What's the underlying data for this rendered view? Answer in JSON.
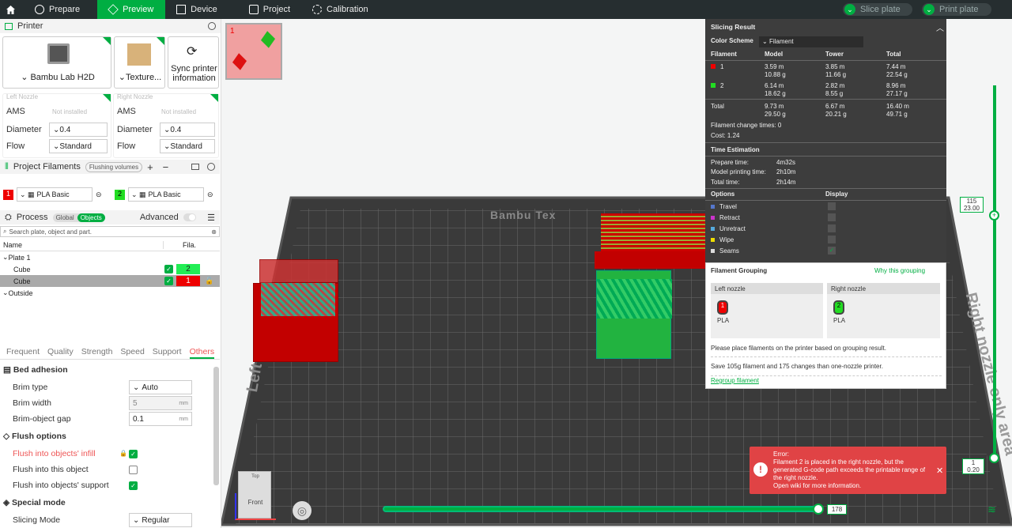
{
  "topbar": {
    "tabs": [
      "Prepare",
      "Preview",
      "Device",
      "Project",
      "Calibration"
    ],
    "slice": "Slice plate",
    "print": "Print plate"
  },
  "printer": {
    "header": "Printer",
    "name": "Bambu Lab H2D",
    "texture": "Texture...",
    "sync": "Sync printer information"
  },
  "nozzles": {
    "left_title": "Left Nozzle",
    "right_title": "Right Nozzle",
    "ams": "AMS",
    "not_installed": "Not installed",
    "diameter_label": "Diameter",
    "diameter": "0.4",
    "flow_label": "Flow",
    "flow": "Standard"
  },
  "filaments": {
    "header": "Project Filaments",
    "flushing": "Flushing volumes",
    "items": [
      {
        "num": "1",
        "name": "PLA Basic",
        "color": "#ee0000"
      },
      {
        "num": "2",
        "name": "PLA Basic",
        "color": "#22dd22"
      }
    ]
  },
  "process": {
    "header": "Process",
    "global": "Global",
    "objects": "Objects",
    "advanced": "Advanced",
    "search_placeholder": "Search plate, object and part.",
    "col_name": "Name",
    "col_fila": "Fila.",
    "plate": "Plate 1",
    "cube1": "Cube",
    "cube1_fila": "2",
    "cube2": "Cube",
    "cube2_fila": "1",
    "outside": "Outside"
  },
  "tabs2": [
    "Frequent",
    "Quality",
    "Strength",
    "Speed",
    "Support",
    "Others"
  ],
  "settings": {
    "bed_adhesion": "Bed adhesion",
    "brim_type": "Brim type",
    "brim_type_val": "Auto",
    "brim_width": "Brim width",
    "brim_width_val": "5",
    "brim_gap": "Brim-object gap",
    "brim_gap_val": "0.1",
    "unit": "mm",
    "flush_options": "Flush options",
    "flush_infill": "Flush into objects' infill",
    "flush_object": "Flush into this object",
    "flush_support": "Flush into objects' support",
    "special": "Special mode",
    "slicing_mode": "Slicing Mode",
    "slicing_mode_val": "Regular"
  },
  "plate_thumb": {
    "num": "1"
  },
  "bed": {
    "brand": "Bambu Tex",
    "left_area": "Left nozz",
    "right_area": "Right nozzle only area"
  },
  "result": {
    "title": "Slicing Result",
    "color_scheme": "Color Scheme",
    "scheme_val": "Filament",
    "cols": [
      "Filament",
      "Model",
      "Tower",
      "Total"
    ],
    "rows": [
      {
        "f": "1",
        "m": "3.59 m",
        "mg": "10.88 g",
        "t": "3.85 m",
        "tg": "11.66 g",
        "tot": "7.44 m",
        "totg": "22.54 g",
        "color": "#ee0000"
      },
      {
        "f": "2",
        "m": "6.14 m",
        "mg": "18.62 g",
        "t": "2.82 m",
        "tg": "8.55 g",
        "tot": "8.96 m",
        "totg": "27.17 g",
        "color": "#22dd22"
      }
    ],
    "total": {
      "label": "Total",
      "m": "9.73 m",
      "mg": "29.50 g",
      "t": "6.67 m",
      "tg": "20.21 g",
      "tot": "16.40 m",
      "totg": "49.71 g"
    },
    "change": "Filament change times:  0",
    "cost": "Cost:  1.24",
    "time_title": "Time Estimation",
    "prepare": "Prepare time:",
    "prepare_v": "4m32s",
    "model_time": "Model printing time:",
    "model_time_v": "2h10m",
    "total_time": "Total time:",
    "total_time_v": "2h14m",
    "options": "Options",
    "display": "Display",
    "opts": [
      {
        "n": "Travel",
        "c": "#5577cc"
      },
      {
        "n": "Retract",
        "c": "#cc33cc"
      },
      {
        "n": "Unretract",
        "c": "#55aadd"
      },
      {
        "n": "Wipe",
        "c": "#eedd00"
      },
      {
        "n": "Seams",
        "c": "#dddddd"
      }
    ]
  },
  "grouping": {
    "title": "Filament Grouping",
    "why": "Why this grouping",
    "left": "Left nozzle",
    "right": "Right nozzle",
    "pla": "PLA",
    "l_num": "1",
    "r_num": "2",
    "msg": "Please place filaments on the printer based on grouping result.",
    "save": "Save 105g filament and 175 changes than one-nozzle printer.",
    "regroup": "Regroup filament"
  },
  "error": {
    "title": "Error:",
    "text": "Filament 2 is placed in the right nozzle, but the generated G-code path exceeds the printable range of the right nozzle.",
    "wiki": "Open wiki for more information."
  },
  "layers": {
    "top": "115",
    "top_h": "23.00",
    "bot": "1",
    "bot_h": "0.20",
    "moves": "178"
  },
  "viewcube": {
    "top": "Top",
    "front": "Front"
  }
}
